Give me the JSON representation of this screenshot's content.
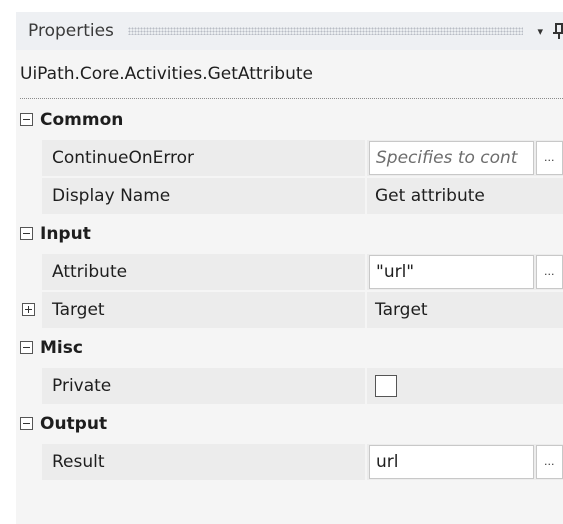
{
  "panel": {
    "title": "Properties",
    "dropdown_icon": "▾",
    "type_name": "UiPath.Core.Activities.GetAttribute"
  },
  "categories": [
    {
      "label": "Common",
      "expanded": true,
      "properties": [
        {
          "name": "ContinueOnError",
          "value": "Specifies to cont",
          "placeholder": true,
          "has_ellipsis": true
        },
        {
          "name": "Display Name",
          "value": "Get attribute"
        }
      ]
    },
    {
      "label": "Input",
      "expanded": true,
      "properties": [
        {
          "name": "Attribute",
          "value": "\"url\"",
          "has_ellipsis": true
        },
        {
          "name": "Target",
          "value": "Target",
          "expandable": true
        }
      ]
    },
    {
      "label": "Misc",
      "expanded": true,
      "properties": [
        {
          "name": "Private",
          "checkbox": true,
          "checked": false
        }
      ]
    },
    {
      "label": "Output",
      "expanded": true,
      "properties": [
        {
          "name": "Result",
          "value": "url",
          "has_ellipsis": true
        }
      ]
    }
  ],
  "ellipsis_label": "..."
}
